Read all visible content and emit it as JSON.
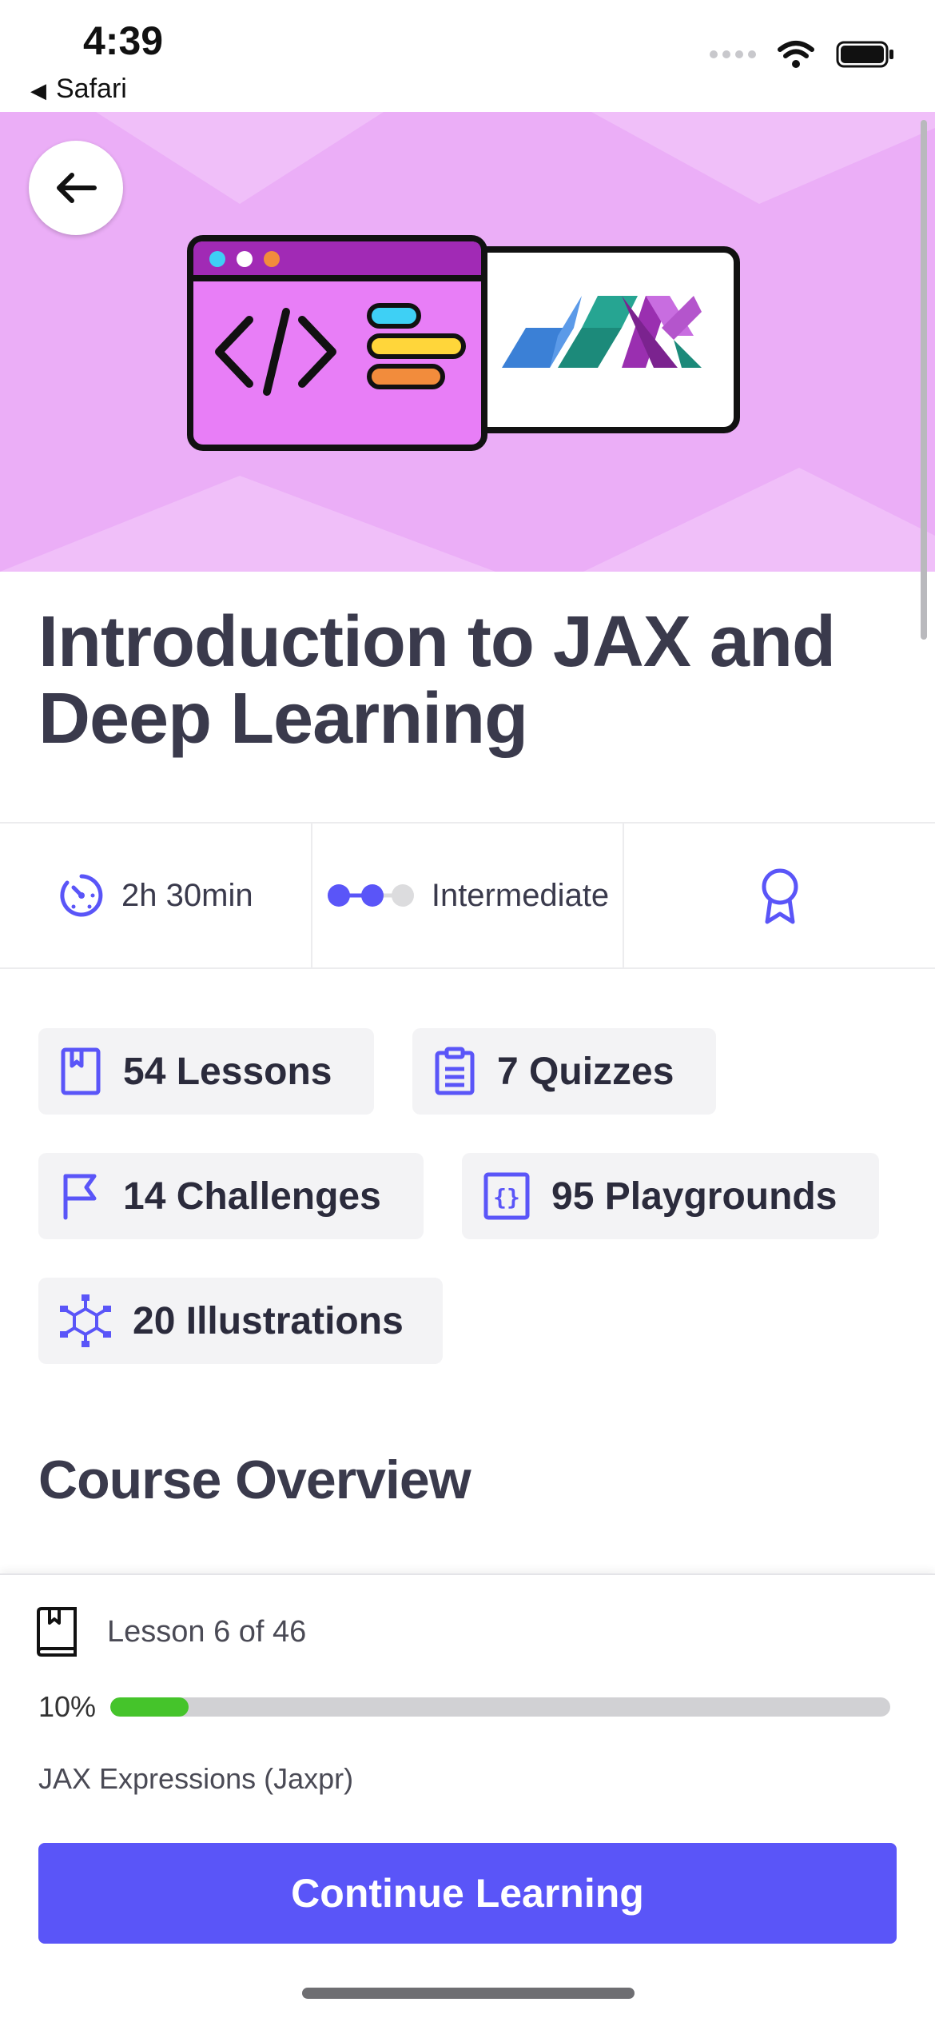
{
  "status_bar": {
    "time": "4:39",
    "back_app": "Safari"
  },
  "hero": {
    "back_icon": "arrow-left-icon",
    "illustration": "code-window-jax-logo",
    "background": "#ebaef7"
  },
  "course": {
    "title": "Introduction to JAX and Deep Learning"
  },
  "info": {
    "duration": "2h 30min",
    "level": "Intermediate",
    "level_steps": 3,
    "level_filled": 2,
    "certificate_icon": "award-ribbon-icon"
  },
  "stats": [
    {
      "label": "54 Lessons",
      "icon": "bookmark-book-icon"
    },
    {
      "label": "7 Quizzes",
      "icon": "clipboard-icon"
    },
    {
      "label": "14 Challenges",
      "icon": "flag-icon"
    },
    {
      "label": "95 Playgrounds",
      "icon": "code-braces-icon"
    },
    {
      "label": "20 Illustrations",
      "icon": "network-cube-icon"
    }
  ],
  "overview": {
    "title": "Course Overview"
  },
  "progress": {
    "lesson": "Lesson 6 of 46",
    "percent_label": "10%",
    "percent": 10,
    "next_lesson": "JAX Expressions (Jaxpr)",
    "button_label": "Continue Learning"
  },
  "colors": {
    "accent": "#5a55f8",
    "progress": "#45c42b"
  }
}
